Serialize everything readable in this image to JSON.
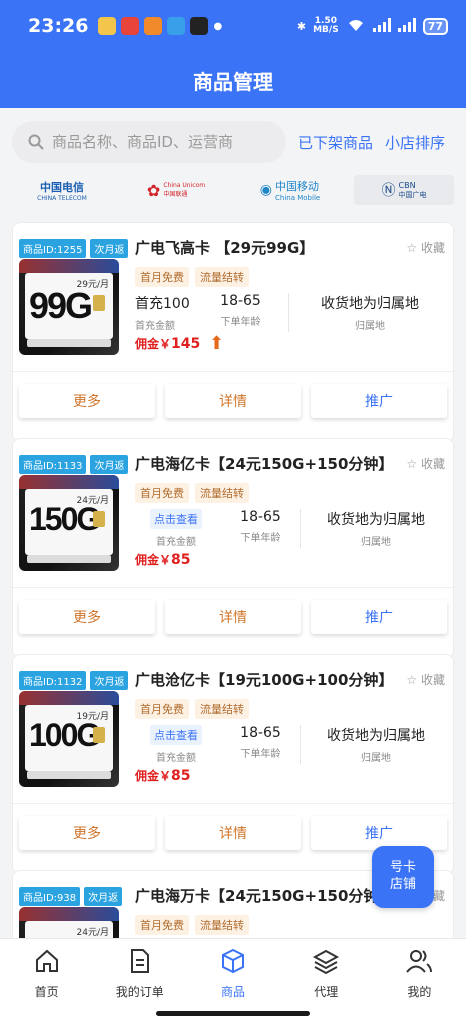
{
  "status_bar": {
    "time": "23:26",
    "net_speed_value": "1.50",
    "net_speed_unit": "MB/S",
    "battery": "77"
  },
  "header": {
    "title": "商品管理"
  },
  "search": {
    "placeholder": "商品名称、商品ID、运营商"
  },
  "top_links": {
    "off_shelf": "已下架商品",
    "shop_sort": "小店排序"
  },
  "carriers": [
    {
      "name": "中国电信",
      "sub": "CHINA TELECOM",
      "color": "#1b5fb2",
      "icon": "china-telecom-logo"
    },
    {
      "name": "China Unicom",
      "sub": "中国联通",
      "color": "#d2232a",
      "icon": "china-unicom-logo"
    },
    {
      "name": "中国移动",
      "sub": "China Mobile",
      "color": "#1f85c9",
      "icon": "china-mobile-logo"
    },
    {
      "name": "CBN",
      "sub": "中国广电",
      "color": "#1b4a8a",
      "icon": "china-broadnet-logo"
    }
  ],
  "products": [
    {
      "id_badge": "商品ID:1255",
      "cycle_badge": "次月返",
      "title": "广电飞高卡 【29元99G】",
      "sim_big": "99G",
      "sim_price": "29元/月",
      "fav": "收藏",
      "tags": [
        "首月免费",
        "流量结转"
      ],
      "recharge": "首充100",
      "recharge_label": "首充金额",
      "age": "18-65",
      "age_label": "下单年龄",
      "location": "收货地为归属地",
      "location_label": "归属地",
      "commission": "佣金￥",
      "commission_amount": "145",
      "actions": {
        "more": "更多",
        "detail": "详情",
        "promote": "推广"
      }
    },
    {
      "id_badge": "商品ID:1133",
      "cycle_badge": "次月返",
      "title": "广电海亿卡【24元150G+150分钟】",
      "sim_big": "150G",
      "sim_price": "24元/月",
      "fav": "收藏",
      "tags": [
        "首月免费",
        "流量结转"
      ],
      "recharge": "点击查看",
      "recharge_label": "首充金额",
      "age": "18-65",
      "age_label": "下单年龄",
      "location": "收货地为归属地",
      "location_label": "归属地",
      "commission": "佣金￥",
      "commission_amount": "85",
      "actions": {
        "more": "更多",
        "detail": "详情",
        "promote": "推广"
      }
    },
    {
      "id_badge": "商品ID:1132",
      "cycle_badge": "次月返",
      "title": "广电沧亿卡【19元100G+100分钟】",
      "sim_big": "100G",
      "sim_price": "19元/月",
      "fav": "收藏",
      "tags": [
        "首月免费",
        "流量结转"
      ],
      "recharge": "点击查看",
      "recharge_label": "首充金额",
      "age": "18-65",
      "age_label": "下单年龄",
      "location": "收货地为归属地",
      "location_label": "归属地",
      "commission": "佣金￥",
      "commission_amount": "85",
      "actions": {
        "more": "更多",
        "detail": "详情",
        "promote": "推广"
      }
    },
    {
      "id_badge": "商品ID:938",
      "cycle_badge": "次月返",
      "title": "广电海万卡【24元150G+150分钟】",
      "sim_big": "",
      "sim_price": "24元/月",
      "fav": "收藏",
      "tags": [
        "首月免费",
        "流量结转"
      ]
    }
  ],
  "float_button": {
    "line1": "号卡",
    "line2": "店铺"
  },
  "tabbar": [
    {
      "label": "首页",
      "icon": "home-icon"
    },
    {
      "label": "我的订单",
      "icon": "order-document-icon"
    },
    {
      "label": "商品",
      "icon": "package-box-icon",
      "active": true
    },
    {
      "label": "代理",
      "icon": "layers-icon"
    },
    {
      "label": "我的",
      "icon": "users-icon"
    }
  ],
  "colors": {
    "primary": "#3a73f5",
    "commission_red": "#e02020",
    "accent_orange": "#d0762a",
    "badge_blue": "#2aa3e0"
  }
}
